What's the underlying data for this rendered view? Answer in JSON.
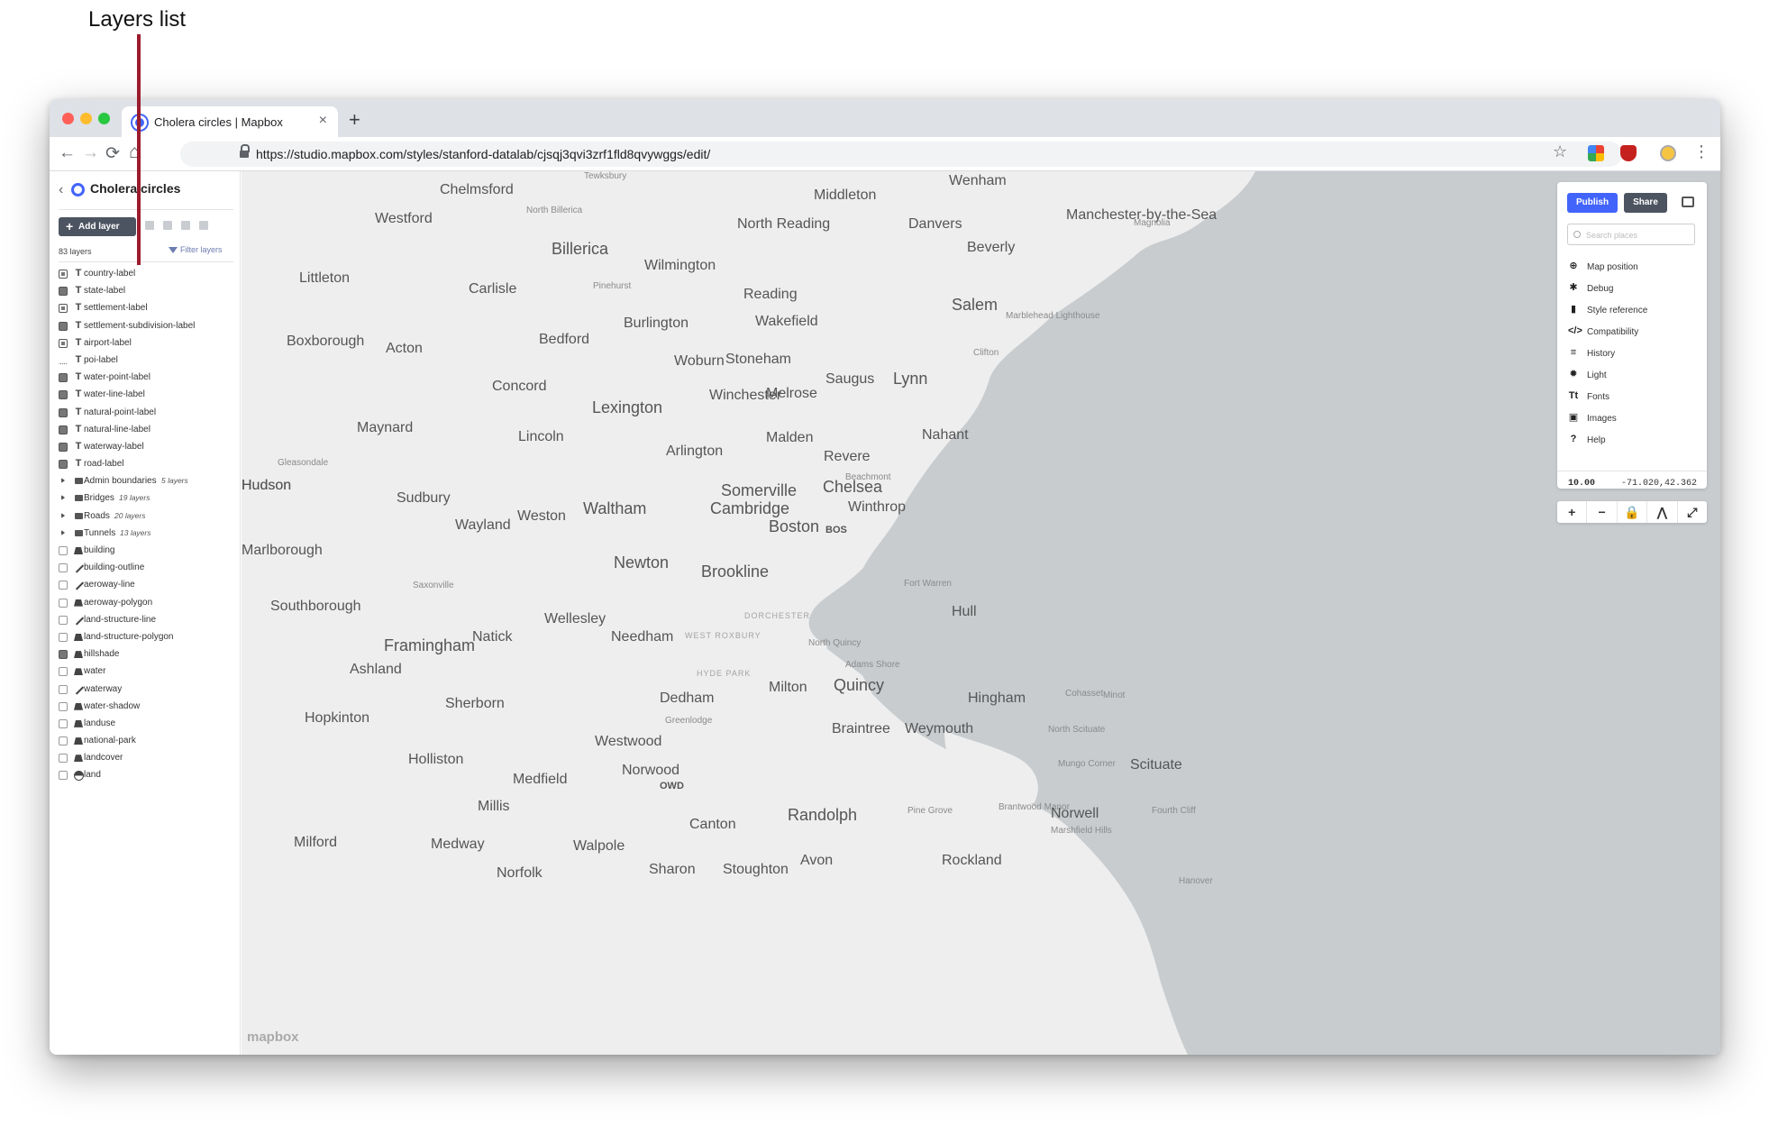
{
  "annotation": {
    "text": "Layers list"
  },
  "browser": {
    "tab_title": "Cholera circles | Mapbox",
    "tab_close": "×",
    "new_tab": "+",
    "back": "←",
    "forward": "→",
    "reload": "⟳",
    "home": "⌂",
    "url": "https://studio.mapbox.com/styles/stanford-datalab/cjsqj3qvi3zrf1fld8qvywggs/edit/",
    "star": "☆",
    "menu": "⋮"
  },
  "sidebar": {
    "back": "‹",
    "title": "Cholera circles",
    "add_layer": "Add layer",
    "layers_count": "83 layers",
    "filter": "Filter layers",
    "layers": [
      {
        "name": "country-label",
        "swatch": "icon",
        "type": "T"
      },
      {
        "name": "state-label",
        "swatch": "filled",
        "type": "T"
      },
      {
        "name": "settlement-label",
        "swatch": "icon",
        "type": "T"
      },
      {
        "name": "settlement-subdivision-label",
        "swatch": "filled",
        "type": "T"
      },
      {
        "name": "airport-label",
        "swatch": "icon",
        "type": "T"
      },
      {
        "name": "poi-label",
        "swatch": "dots",
        "type": "T"
      },
      {
        "name": "water-point-label",
        "swatch": "filled",
        "type": "T"
      },
      {
        "name": "water-line-label",
        "swatch": "filled",
        "type": "T"
      },
      {
        "name": "natural-point-label",
        "swatch": "filled",
        "type": "T"
      },
      {
        "name": "natural-line-label",
        "swatch": "filled",
        "type": "T"
      },
      {
        "name": "waterway-label",
        "swatch": "filled",
        "type": "T"
      },
      {
        "name": "road-label",
        "swatch": "filled",
        "type": "T"
      },
      {
        "name": "Admin boundaries",
        "swatch": "expand",
        "type": "folder",
        "meta": "5 layers"
      },
      {
        "name": "Bridges",
        "swatch": "expand",
        "type": "folder",
        "meta": "19 layers"
      },
      {
        "name": "Roads",
        "swatch": "expand",
        "type": "folder",
        "meta": "20 layers"
      },
      {
        "name": "Tunnels",
        "swatch": "expand",
        "type": "folder",
        "meta": "13 layers"
      },
      {
        "name": "building",
        "swatch": "empty",
        "type": "fill"
      },
      {
        "name": "building-outline",
        "swatch": "empty",
        "type": "line"
      },
      {
        "name": "aeroway-line",
        "swatch": "empty",
        "type": "line"
      },
      {
        "name": "aeroway-polygon",
        "swatch": "empty",
        "type": "fill"
      },
      {
        "name": "land-structure-line",
        "swatch": "empty",
        "type": "line"
      },
      {
        "name": "land-structure-polygon",
        "swatch": "empty",
        "type": "fill"
      },
      {
        "name": "hillshade",
        "swatch": "filled",
        "type": "fill"
      },
      {
        "name": "water",
        "swatch": "empty",
        "type": "fill"
      },
      {
        "name": "waterway",
        "swatch": "empty",
        "type": "line"
      },
      {
        "name": "water-shadow",
        "swatch": "empty",
        "type": "fill"
      },
      {
        "name": "landuse",
        "swatch": "empty",
        "type": "fill"
      },
      {
        "name": "national-park",
        "swatch": "empty",
        "type": "fill"
      },
      {
        "name": "landcover",
        "swatch": "empty",
        "type": "fill"
      },
      {
        "name": "land",
        "swatch": "empty",
        "type": "bg"
      }
    ]
  },
  "panel": {
    "publish": "Publish",
    "share": "Share",
    "search_placeholder": "Search places",
    "menu": [
      {
        "label": "Map position",
        "icon": "crosshair-icon",
        "glyph": "⊕"
      },
      {
        "label": "Debug",
        "icon": "bug-icon",
        "glyph": "✱"
      },
      {
        "label": "Style reference",
        "icon": "book-icon",
        "glyph": "▮"
      },
      {
        "label": "Compatibility",
        "icon": "code-icon",
        "glyph": "</>"
      },
      {
        "label": "History",
        "icon": "history-icon",
        "glyph": "≡"
      },
      {
        "label": "Light",
        "icon": "sun-icon",
        "glyph": "✹"
      },
      {
        "label": "Fonts",
        "icon": "font-icon",
        "glyph": "Tt"
      },
      {
        "label": "Images",
        "icon": "image-icon",
        "glyph": "▣"
      },
      {
        "label": "Help",
        "icon": "help-icon",
        "glyph": "?"
      }
    ],
    "zoom": "10.00",
    "coordinates": "-71.020,42.362"
  },
  "controls": [
    "+",
    "−",
    "🔒",
    "⋀",
    "⤢"
  ],
  "map": {
    "attribution": "mapbox",
    "colors": {
      "land": "#eeeeee",
      "water": "#c8cccf"
    },
    "labels": [
      "Chelmsford",
      "Tewksbury",
      "North Billerica",
      "Westford",
      "Billerica",
      "Wilmington",
      "North Reading",
      "Middleton",
      "Wenham",
      "Danvers",
      "Beverly",
      "Manchester-by-the-Sea",
      "Magnolia",
      "Littleton",
      "Carlisle",
      "Pinehurst",
      "Reading",
      "Burlington",
      "Wakefield",
      "Salem",
      "Marblehead Lighthouse",
      "Clifton",
      "Boxborough",
      "Acton",
      "Bedford",
      "Woburn",
      "Stoneham",
      "Concord",
      "Saugus",
      "Lynn",
      "Winchester",
      "Melrose",
      "Lexington",
      "Maynard",
      "Lincoln",
      "Malden",
      "Nahant",
      "Arlington",
      "Revere",
      "Gleasondale",
      "Beachmont",
      "Hudson",
      "Sudbury",
      "Somerville",
      "Chelsea",
      "Waltham",
      "Cambridge",
      "Winthrop",
      "Wayland",
      "Weston",
      "Boston",
      "BOS",
      "Marlborough",
      "Newton",
      "Brookline",
      "Saxonville",
      "Fort Warren",
      "Southborough",
      "DORCHESTER",
      "Hull",
      "Wellesley",
      "Natick",
      "Needham",
      "WEST ROXBURY",
      "North Quincy",
      "Framingham",
      "Ashland",
      "Adams Shore",
      "HYDE PARK",
      "Milton",
      "Quincy",
      "Dedham",
      "Hingham",
      "Cohasset",
      "Minot",
      "Sherborn",
      "Hopkinton",
      "Greenlodge",
      "Braintree",
      "Weymouth",
      "North Scituate",
      "Westwood",
      "Holliston",
      "Norwood",
      "Mungo Corner",
      "Scituate",
      "Medfield",
      "OWD",
      "Millis",
      "Randolph",
      "Pine Grove",
      "Brantwood Manor",
      "Norwell",
      "Fourth Cliff",
      "Canton",
      "Marshfield Hills",
      "Milford",
      "Medway",
      "Walpole",
      "Avon",
      "Rockland",
      "Sharon",
      "Stoughton",
      "Norfolk",
      "Hanover",
      "Hudson"
    ]
  }
}
